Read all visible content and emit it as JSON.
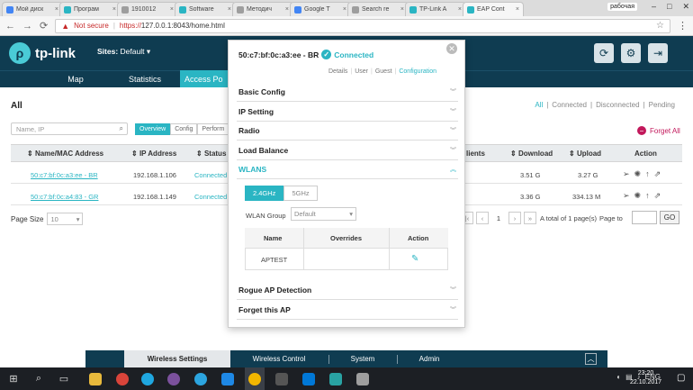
{
  "browser": {
    "tabs": [
      {
        "label": "Мой диск",
        "color": "#4285f4"
      },
      {
        "label": "Програм",
        "color": "#2ab5c3"
      },
      {
        "label": "1910012",
        "color": "#9e9e9e"
      },
      {
        "label": "Software",
        "color": "#2ab5c3"
      },
      {
        "label": "Методич",
        "color": "#9e9e9e"
      },
      {
        "label": "Google T",
        "color": "#4285f4"
      },
      {
        "label": "Search re",
        "color": "#9e9e9e"
      },
      {
        "label": "TP-Link A",
        "color": "#2ab5c3"
      },
      {
        "label": "EAP Cont",
        "color": "#2ab5c3"
      }
    ],
    "profile": "рабочая",
    "not_secure": "Not secure",
    "url_proto": "https://",
    "url_rest": "127.0.0.1:8043/home.html"
  },
  "header": {
    "logo_text": "tp-link",
    "sites_label": "Sites:",
    "sites_value": "Default"
  },
  "nav": [
    "Map",
    "Statistics",
    "Access Po"
  ],
  "page": {
    "title": "All",
    "filters": [
      "All",
      "Connected",
      "Disconnected",
      "Pending"
    ],
    "search_placeholder": "Name, IP",
    "subtabs": [
      "Overview",
      "Config",
      "Perform"
    ],
    "forget_all": "Forget All",
    "columns": {
      "name": "Name/MAC Address",
      "ip": "IP Address",
      "status": "Status",
      "clients": "lients",
      "download": "Download",
      "upload": "Upload",
      "action": "Action"
    },
    "rows": [
      {
        "name": "50:c7:bf:0c:a3:ee - BR",
        "ip": "192.168.1.106",
        "status": "Connected",
        "download": "3.51 G",
        "upload": "3.27 G"
      },
      {
        "name": "50:c7:bf:0c:a4:83 - GR",
        "ip": "192.168.1.149",
        "status": "Connected",
        "download": "3.36 G",
        "upload": "334.13 M"
      }
    ],
    "page_size_label": "Page Size",
    "page_size_value": "10",
    "current_page": "1",
    "total_text": "A total of 1 page(s)",
    "page_to": "Page to",
    "go": "GO"
  },
  "modal": {
    "device": "50:c7:bf:0c:a3:ee - BR",
    "status": "Connected",
    "tabs": [
      "Details",
      "User",
      "Guest",
      "Configuration"
    ],
    "sections": [
      "Basic Config",
      "IP Setting",
      "Radio",
      "Load Balance",
      "WLANS"
    ],
    "bands": [
      "2.4GHz",
      "5GHz"
    ],
    "wlan_group_label": "WLAN Group",
    "wlan_group_value": "Default",
    "wlan_cols": [
      "Name",
      "Overrides",
      "Action"
    ],
    "wlan_name": "APTEST",
    "lower_sections": [
      "Rogue AP Detection",
      "Forget this AP"
    ]
  },
  "bottom": {
    "items": [
      "Wireless Settings",
      "Wireless Control",
      "System",
      "Admin"
    ]
  },
  "taskbar": {
    "lang": "ENG",
    "time": "23:20",
    "date": "22.10.2017"
  }
}
